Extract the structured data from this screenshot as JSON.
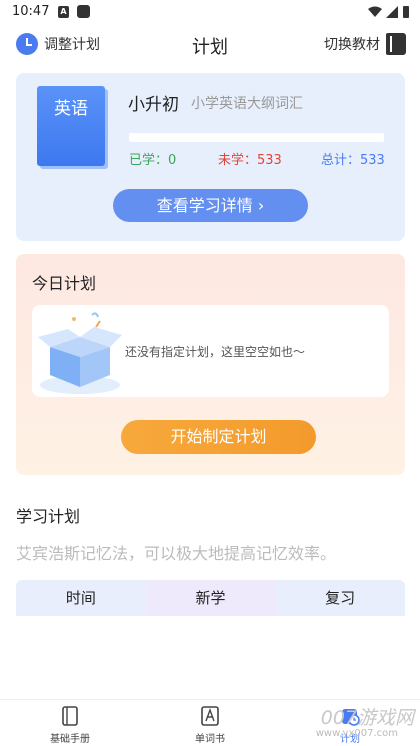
{
  "status_bar": {
    "time": "10:47",
    "a_glyph": "A"
  },
  "header": {
    "left_label": "调整计划",
    "title": "计划",
    "right_label": "切换教材"
  },
  "book": {
    "cover_label": "英语",
    "level": "小升初",
    "name": "小学英语大纲词汇",
    "progress": 0,
    "learned": "已学：0",
    "unlearned": "未学：533",
    "total": "总计：533",
    "detail_button": "查看学习详情 ›"
  },
  "today_plan": {
    "title": "今日计划",
    "empty_text": "还没有指定计划，这里空空如也～",
    "start_button": "开始制定计划"
  },
  "study_plan": {
    "title": "学习计划",
    "description": "艾宾浩斯记忆法，可以极大地提高记忆效率。",
    "columns": [
      "时间",
      "新学",
      "复习"
    ]
  },
  "nav": {
    "items": [
      {
        "label": "基础手册",
        "icon": "handbook-icon"
      },
      {
        "label": "单词书",
        "icon": "word-book-icon"
      },
      {
        "label": "计划",
        "icon": "plan-icon"
      }
    ]
  },
  "watermark": {
    "main": "007游戏网",
    "sub": "www.yx007.com"
  },
  "colors": {
    "accent": "#4a7bf0",
    "orange": "#f49a2c",
    "learned": "#3aa55a",
    "unlearned": "#e0453a"
  }
}
